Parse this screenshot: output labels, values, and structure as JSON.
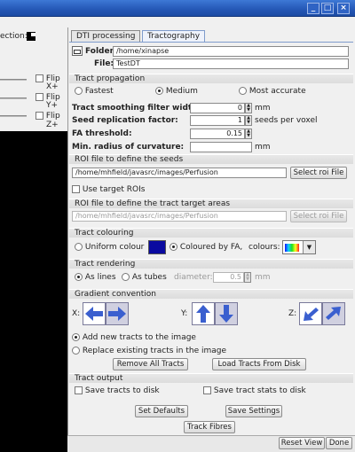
{
  "window": {
    "controls": [
      "_",
      "□",
      "×"
    ],
    "reset_view_label": "Reset View",
    "done_label": "Done"
  },
  "left_panel": {
    "projection_label": "ection:",
    "axes": [
      {
        "axis": "X+",
        "flip_label": "Flip"
      },
      {
        "axis": "Y+",
        "flip_label": "Flip"
      },
      {
        "axis": "Z+",
        "flip_label": "Flip"
      }
    ]
  },
  "tabs": [
    {
      "label": "DTI processing",
      "active": false
    },
    {
      "label": "Tractography",
      "active": true
    }
  ],
  "folder": {
    "label": "Folder:",
    "value": "/home/xinapse"
  },
  "file": {
    "label": "File:",
    "value": "TestDT"
  },
  "propagation": {
    "title": "Tract propagation",
    "options": [
      {
        "label": "Fastest",
        "selected": false
      },
      {
        "label": "Medium",
        "selected": true
      },
      {
        "label": "Most accurate",
        "selected": false
      }
    ]
  },
  "params": {
    "smoothing": {
      "label": "Tract smoothing filter width:",
      "value": "0",
      "unit": "mm"
    },
    "seed_rep": {
      "label": "Seed replication factor:",
      "value": "1",
      "unit": "seeds per voxel"
    },
    "fa": {
      "label": "FA threshold:",
      "value": "0.15"
    },
    "curv": {
      "label": "Min. radius of curvature:",
      "value": "",
      "unit": "mm"
    }
  },
  "roi_seed": {
    "title": "ROI file to define the seeds",
    "path": "/home/mhfield/javasrc/images/Perfusion",
    "button": "Select roi File"
  },
  "target_rois": {
    "label": "Use target ROIs",
    "checked": false
  },
  "roi_target": {
    "title": "ROI file to define the tract target areas",
    "path": "/home/mhfield/javasrc/images/Perfusion",
    "button": "Select roi File"
  },
  "colouring": {
    "title": "Tract colouring",
    "uniform_label": "Uniform colour",
    "uniform_selected": false,
    "fa_label": "Coloured by FA,",
    "fa_selected": true,
    "colours_label": "colours:",
    "uniform_color": "#0a0aa0"
  },
  "rendering": {
    "title": "Tract rendering",
    "lines_label": "As lines",
    "lines_selected": true,
    "tubes_label": "As tubes",
    "tubes_selected": false,
    "diameter_label": "diameter:",
    "diameter_value": "0.5",
    "diameter_unit": "mm"
  },
  "gradient": {
    "title": "Gradient convention",
    "x_label": "X:",
    "y_label": "Y:",
    "z_label": "Z:",
    "arrow_color": "#3a5fcf"
  },
  "tract_mode": {
    "add_label": "Add new tracts to the image",
    "add_selected": true,
    "replace_label": "Replace existing tracts in the image",
    "replace_selected": false,
    "remove_button": "Remove All Tracts",
    "load_button": "Load Tracts From Disk"
  },
  "output": {
    "title": "Tract output",
    "save_tracts_label": "Save tracts to disk",
    "save_stats_label": "Save tract stats to disk"
  },
  "footer": {
    "set_defaults": "Set Defaults",
    "save_settings": "Save Settings",
    "track_fibres": "Track Fibres"
  }
}
